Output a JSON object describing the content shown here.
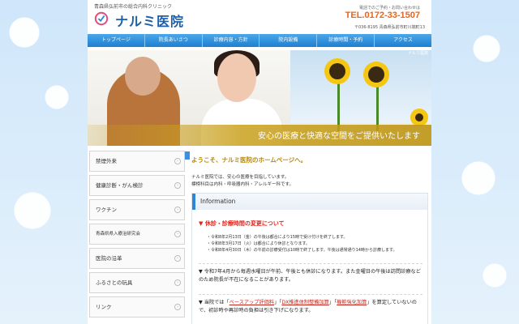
{
  "header": {
    "tagline": "青森県弘前市の総合内科クリニック",
    "title": "ナルミ医院",
    "reserve_note": "電話でのご予約・お問い合わせは",
    "tel": "TEL.0172-33-1507",
    "address": "〒036-8195 青森県弘前市町川端町13"
  },
  "nav": [
    "トップページ",
    "院長あいさつ",
    "診療内容・方針",
    "院内設備",
    "診療時間・予約",
    "アクセス"
  ],
  "hero": {
    "corner_label": "ナルミ医院",
    "caption": "安心の医療と快適な空間をご提供いたします"
  },
  "sidebar": [
    "禁煙外来",
    "健康診断・がん検診",
    "ワクチン",
    "青森県県入療治研究会",
    "医院の沿革",
    "ふるさとの玩具",
    "リンク"
  ],
  "main": {
    "welcome": "ようこそ、ナルミ医院のホームページへ。",
    "intro_lines": [
      "ナルミ医院では、安心の医療を目指しています。",
      "標榜科目は内科・呼吸器内科・アレルギー科です。"
    ],
    "info_title": "Information",
    "notice_title": "休診・診療時間の変更について",
    "notice_items": [
      "・令和8年2月13日（金）の午後は都合により15時で受け付けを終了します。",
      "・令和8年3月17日（火）は都合により休診となります。",
      "・令和8年4月30日（木）の午前の診療受付は10時で終了します。午後は通常通り14時から診療します。"
    ],
    "para2": "令和7年4月から毎週水曜日が午前、午後とも休診になります。また金曜日の午後は訪問診療などのため院長が不在になることがあります。",
    "para3_prefix": "当院では「",
    "para3_link1": "ベースアップ評価料",
    "para3_mid1": "」「",
    "para3_link2": "DX推進体制整備加算",
    "para3_mid2": "」「",
    "para3_link3": "機能強化加算",
    "para3_suffix": "」を算定していないので、初診時や再診時の負担は引き下げになります。"
  },
  "colors": {
    "brand_blue": "#1d5fa8",
    "tel_orange": "#e8651b",
    "notice_red": "#e0261c",
    "welcome_gold": "#b8870e"
  }
}
